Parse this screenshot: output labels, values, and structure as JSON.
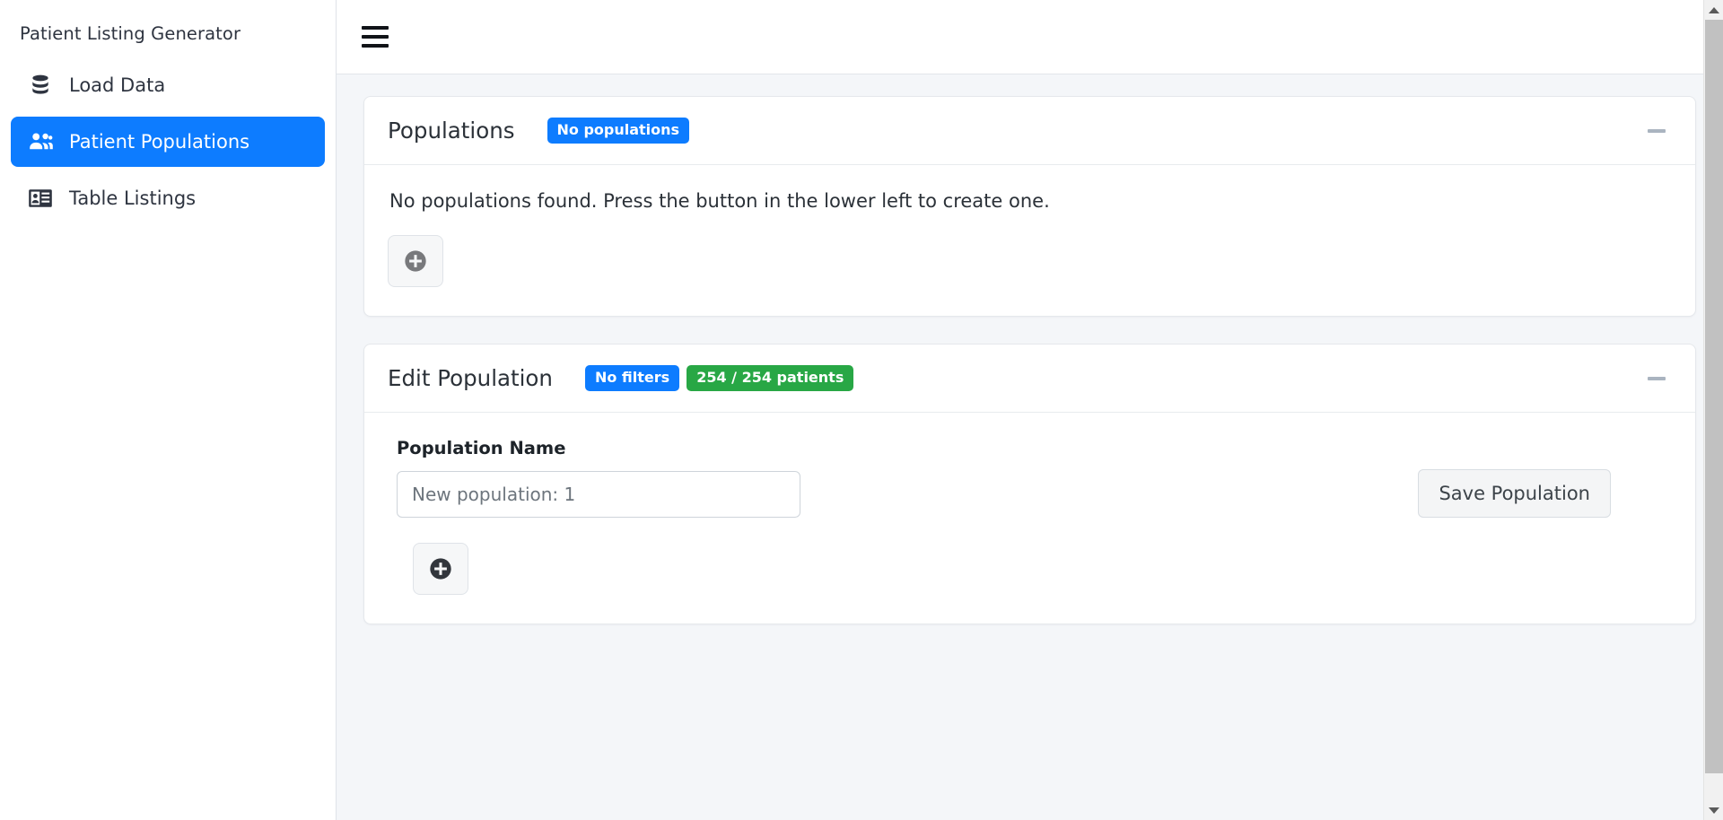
{
  "app": {
    "brand": "Patient Listing Generator"
  },
  "sidebar": {
    "items": [
      {
        "label": "Load Data",
        "icon": "database-icon",
        "active": false
      },
      {
        "label": "Patient Populations",
        "icon": "users-icon",
        "active": true
      },
      {
        "label": "Table Listings",
        "icon": "id-card-icon",
        "active": false
      }
    ]
  },
  "topbar": {
    "menu_icon": "hamburger-icon"
  },
  "cards": {
    "populations": {
      "title": "Populations",
      "badge": "No populations",
      "badge_color": "#0d7cff",
      "collapse_icon": "minus-icon",
      "empty_message": "No populations found. Press the button in the lower left to create one.",
      "add_button_icon": "plus-circle-icon",
      "add_button_state": "disabled"
    },
    "edit_population": {
      "title": "Edit Population",
      "badges": [
        {
          "label": "No filters",
          "color": "#0d7cff"
        },
        {
          "label": "254 / 254 patients",
          "color": "#28a745"
        }
      ],
      "collapse_icon": "minus-icon",
      "field_label": "Population Name",
      "field_value": "",
      "field_placeholder": "New population: 1",
      "save_label": "Save Population",
      "add_button_icon": "plus-circle-icon",
      "add_button_state": "enabled"
    }
  },
  "scrollbar": {
    "up_icon": "caret-up-icon",
    "down_icon": "caret-down-icon"
  },
  "colors": {
    "accent": "#0d7cff",
    "success": "#28a745",
    "page_bg": "#f4f6f9",
    "card_bg": "#ffffff"
  }
}
